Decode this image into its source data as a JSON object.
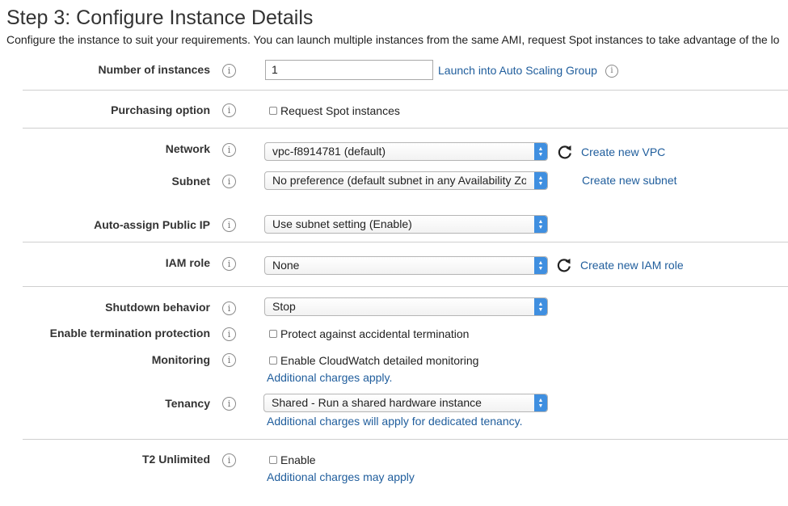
{
  "page": {
    "title": "Step 3: Configure Instance Details",
    "subtitle": "Configure the instance to suit your requirements. You can launch multiple instances from the same AMI, request Spot instances to take advantage of the lo"
  },
  "info_icon_glyph": "i",
  "number_of_instances": {
    "label": "Number of instances",
    "value": "1",
    "asg_link": "Launch into Auto Scaling Group"
  },
  "purchasing_option": {
    "label": "Purchasing option",
    "checkbox_label": "Request Spot instances"
  },
  "network": {
    "label": "Network",
    "value": "vpc-f8914781 (default)",
    "create_link": "Create new VPC"
  },
  "subnet": {
    "label": "Subnet",
    "value": "No preference (default subnet in any Availability Zo",
    "create_link": "Create new subnet"
  },
  "auto_assign_ip": {
    "label": "Auto-assign Public IP",
    "value": "Use subnet setting (Enable)"
  },
  "iam_role": {
    "label": "IAM role",
    "value": "None",
    "create_link": "Create new IAM role"
  },
  "shutdown": {
    "label": "Shutdown behavior",
    "value": "Stop"
  },
  "termination": {
    "label": "Enable termination protection",
    "checkbox_label": "Protect against accidental termination"
  },
  "monitoring": {
    "label": "Monitoring",
    "checkbox_label": "Enable CloudWatch detailed monitoring",
    "note": "Additional charges apply."
  },
  "tenancy": {
    "label": "Tenancy",
    "value": "Shared - Run a shared hardware instance",
    "note": "Additional charges will apply for dedicated tenancy."
  },
  "t2_unlimited": {
    "label": "T2 Unlimited",
    "checkbox_label": "Enable",
    "note": "Additional charges may apply"
  },
  "colors": {
    "link": "#1f5d9c",
    "select_arrow": "#3f8fe0",
    "divider": "#cfcfcf"
  }
}
